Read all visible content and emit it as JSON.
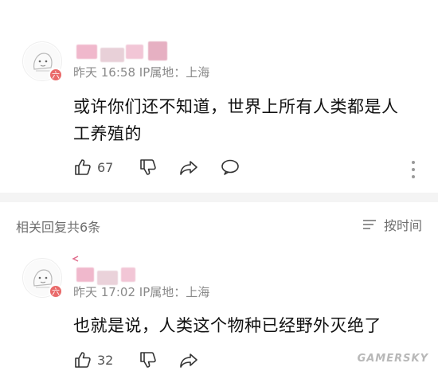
{
  "comment1": {
    "meta": "昨天 16:58 IP属地：上海",
    "avatar_badge": "六",
    "text_line1": "或许你们还不知道，世界上所有人类都是人",
    "text_line2": "工养殖的",
    "like_count": "67"
  },
  "replies_section": {
    "header": "相关回复共6条",
    "sort_label": "按时间"
  },
  "comment2": {
    "meta": "昨天 17:02 IP属地：上海",
    "avatar_badge": "六",
    "text": "也就是说，人类这个物种已经野外灭绝了",
    "like_count": "32"
  },
  "watermark": "GAMERSKY",
  "colors": {
    "meta_text": "#8a8a8a",
    "badge": "#e96a6a",
    "divider": "#f4f4f4"
  },
  "icons": [
    "thumbs-up-icon",
    "thumbs-down-icon",
    "share-icon",
    "comment-icon",
    "more-icon",
    "sort-icon"
  ]
}
